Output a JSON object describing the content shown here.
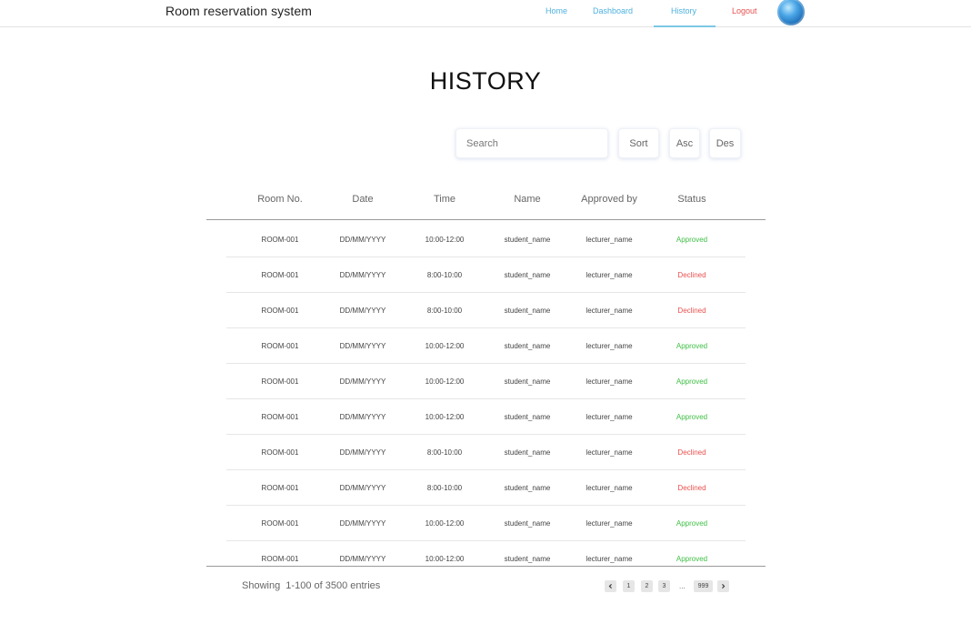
{
  "header": {
    "app_title": "Room reservation system",
    "nav": [
      {
        "label": "Home"
      },
      {
        "label": "Dashboard"
      },
      {
        "label": "History",
        "active": true
      },
      {
        "label": "Logout"
      }
    ],
    "accent_color": "#4eb1de",
    "logout_color": "#e9504f"
  },
  "page": {
    "title": "HISTORY"
  },
  "controls": {
    "search_placeholder": "Search",
    "sort_label": "Sort",
    "asc_label": "Asc",
    "des_label": "Des"
  },
  "table": {
    "columns": [
      "Room No.",
      "Date",
      "Time",
      "Name",
      "Approved by",
      "Status"
    ],
    "rows": [
      {
        "room": "ROOM-001",
        "date": "DD/MM/YYYY",
        "time": "10:00-12:00",
        "name": "student_name",
        "approved_by": "lecturer_name",
        "status": "Approved"
      },
      {
        "room": "ROOM-001",
        "date": "DD/MM/YYYY",
        "time": "8:00-10:00",
        "name": "student_name",
        "approved_by": "lecturer_name",
        "status": "Declined"
      },
      {
        "room": "ROOM-001",
        "date": "DD/MM/YYYY",
        "time": "8:00-10:00",
        "name": "student_name",
        "approved_by": "lecturer_name",
        "status": "Declined"
      },
      {
        "room": "ROOM-001",
        "date": "DD/MM/YYYY",
        "time": "10:00-12:00",
        "name": "student_name",
        "approved_by": "lecturer_name",
        "status": "Approved"
      },
      {
        "room": "ROOM-001",
        "date": "DD/MM/YYYY",
        "time": "10:00-12:00",
        "name": "student_name",
        "approved_by": "lecturer_name",
        "status": "Approved"
      },
      {
        "room": "ROOM-001",
        "date": "DD/MM/YYYY",
        "time": "10:00-12:00",
        "name": "student_name",
        "approved_by": "lecturer_name",
        "status": "Approved"
      },
      {
        "room": "ROOM-001",
        "date": "DD/MM/YYYY",
        "time": "8:00-10:00",
        "name": "student_name",
        "approved_by": "lecturer_name",
        "status": "Declined"
      },
      {
        "room": "ROOM-001",
        "date": "DD/MM/YYYY",
        "time": "8:00-10:00",
        "name": "student_name",
        "approved_by": "lecturer_name",
        "status": "Declined"
      },
      {
        "room": "ROOM-001",
        "date": "DD/MM/YYYY",
        "time": "10:00-12:00",
        "name": "student_name",
        "approved_by": "lecturer_name",
        "status": "Approved"
      },
      {
        "room": "ROOM-001",
        "date": "DD/MM/YYYY",
        "time": "10:00-12:00",
        "name": "student_name",
        "approved_by": "lecturer_name",
        "status": "Approved"
      }
    ],
    "status_colors": {
      "Approved": "#3fbf45",
      "Declined": "#e9504f"
    }
  },
  "footer": {
    "showing_text": "Showing  1-100 of 3500 entries",
    "pager": {
      "prev_icon": "chevron-left-icon",
      "pages": [
        "1",
        "2",
        "3"
      ],
      "ellipsis": "...",
      "last_page": "999",
      "next_icon": "chevron-right-icon"
    }
  }
}
